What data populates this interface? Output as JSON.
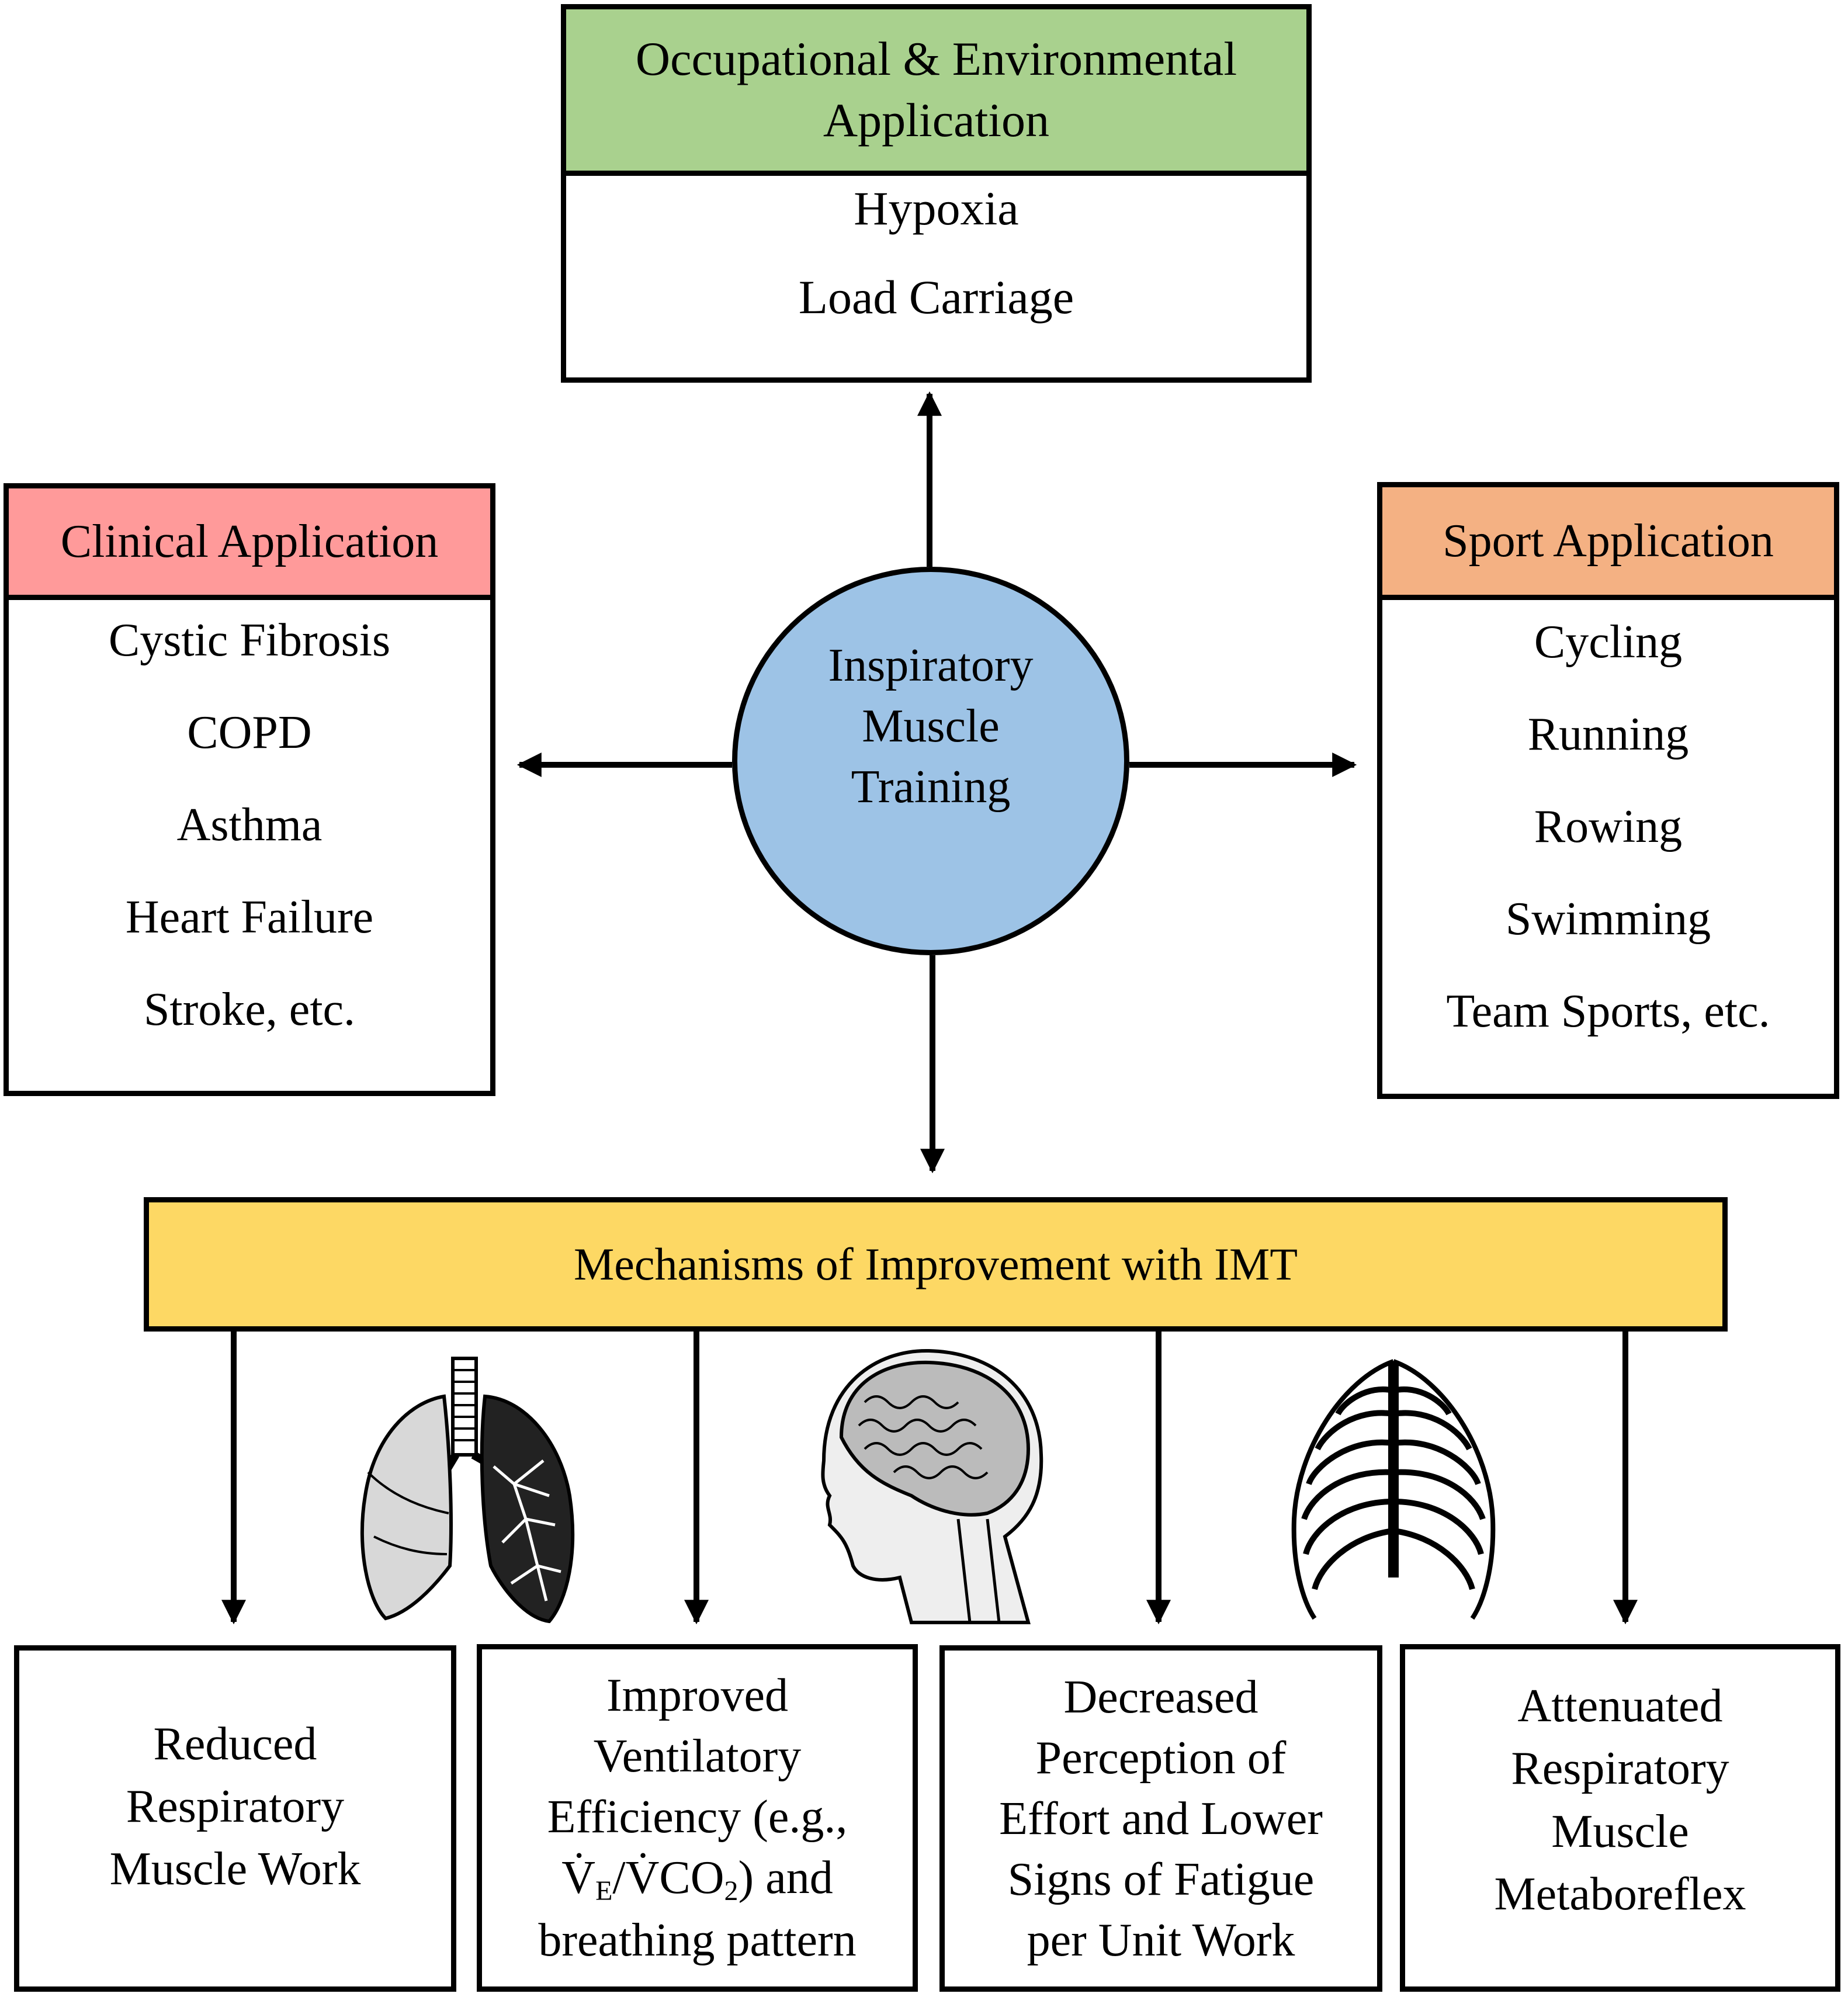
{
  "center": {
    "lines": [
      "Inspiratory",
      "Muscle",
      "Training"
    ],
    "color": "#9DC3E6"
  },
  "occupational": {
    "title_lines": [
      "Occupational & Environmental",
      "Application"
    ],
    "header_color": "#A9D18E",
    "items": [
      "Hypoxia",
      "Load Carriage"
    ]
  },
  "clinical": {
    "title": "Clinical Application",
    "header_color": "#FF9A9A",
    "items": [
      "Cystic Fibrosis",
      "COPD",
      "Asthma",
      "Heart Failure",
      "Stroke, etc."
    ]
  },
  "sport": {
    "title": "Sport Application",
    "header_color": "#F4B183",
    "items": [
      "Cycling",
      "Running",
      "Rowing",
      "Swimming",
      "Team Sports, etc."
    ]
  },
  "mechanisms": {
    "title": "Mechanisms of Improvement with IMT",
    "color": "#FDD864",
    "illustrations": [
      "lungs-illustration",
      "head-brain-illustration",
      "ribcage-illustration"
    ],
    "boxes": [
      {
        "lines": [
          "Reduced",
          "Respiratory",
          "Muscle Work"
        ]
      },
      {
        "lines": [
          "Improved",
          "Ventilatory",
          "Efficiency (e.g.,",
          "V̇E/V̇CO2) and",
          "breathing pattern"
        ],
        "formula": {
          "v1": "V̇",
          "sub1": "E",
          "slash": "/",
          "v2": "V̇CO",
          "sub2": "2",
          "tail": ") and"
        }
      },
      {
        "lines": [
          "Decreased",
          "Perception of",
          "Effort and Lower",
          "Signs of Fatigue",
          "per Unit Work"
        ]
      },
      {
        "lines": [
          "Attenuated",
          "Respiratory",
          "Muscle",
          "Metaboreflex"
        ]
      }
    ]
  }
}
